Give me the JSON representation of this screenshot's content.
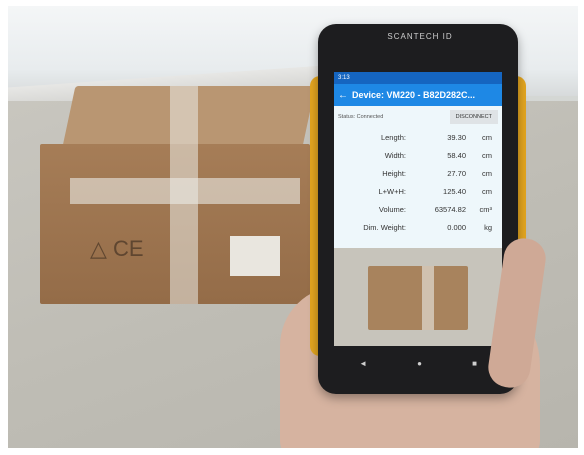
{
  "phone": {
    "brand": "SCANTECH ID",
    "status_time": "3:13",
    "title": "Device: VM220 - B82D282C...",
    "status": "Status: Connected",
    "disconnect_label": "DISCONNECT",
    "measurements": [
      {
        "label": "Length:",
        "value": "39.30",
        "unit": "cm"
      },
      {
        "label": "Width:",
        "value": "58.40",
        "unit": "cm"
      },
      {
        "label": "Height:",
        "value": "27.70",
        "unit": "cm"
      },
      {
        "label": "L+W+H:",
        "value": "125.40",
        "unit": "cm"
      },
      {
        "label": "Volume:",
        "value": "63574.82",
        "unit": "cm³"
      },
      {
        "label": "Dim. Weight:",
        "value": "0.000",
        "unit": "kg"
      }
    ],
    "nav": {
      "back": "◄",
      "home": "●",
      "recent": "■"
    }
  },
  "colors": {
    "appbar": "#1e88e5",
    "bumper": "#e3a520",
    "box": "#a67d57"
  }
}
